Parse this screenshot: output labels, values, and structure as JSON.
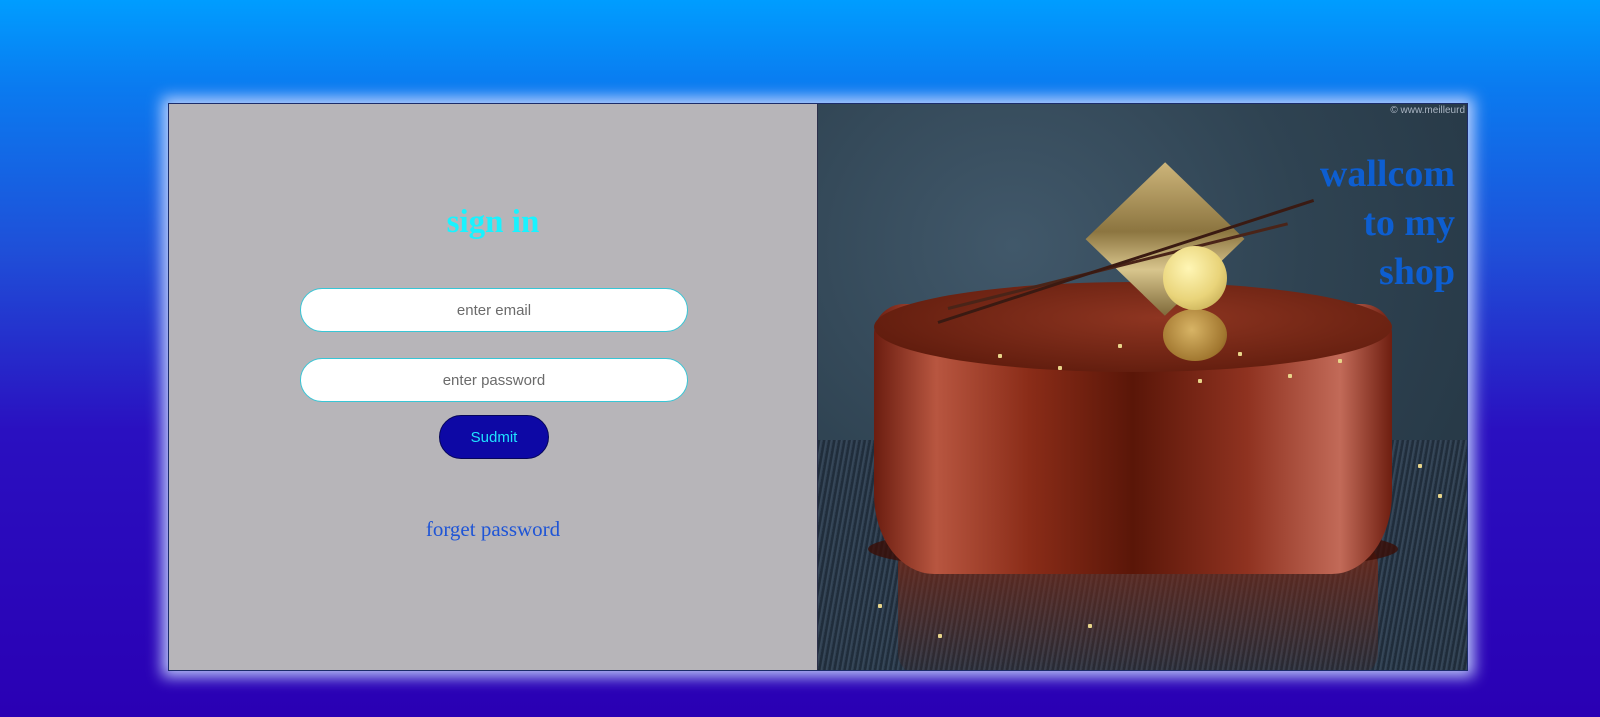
{
  "signin": {
    "title": "sign in",
    "email_placeholder": "enter email",
    "password_placeholder": "enter password",
    "submit_label": "Sudmit",
    "forget_label": "forget password"
  },
  "hero": {
    "welcome_line1": "wallcom",
    "welcome_line2": "to my",
    "welcome_line3": "shop",
    "copyright": "© www.meilleurd"
  },
  "colors": {
    "title": "#19f3ff",
    "submit_bg": "#0d08a5",
    "submit_text": "#1fe2ff",
    "link": "#1f55d6",
    "welcome": "#0d5ed1",
    "panel_bg": "#b7b5b9"
  }
}
